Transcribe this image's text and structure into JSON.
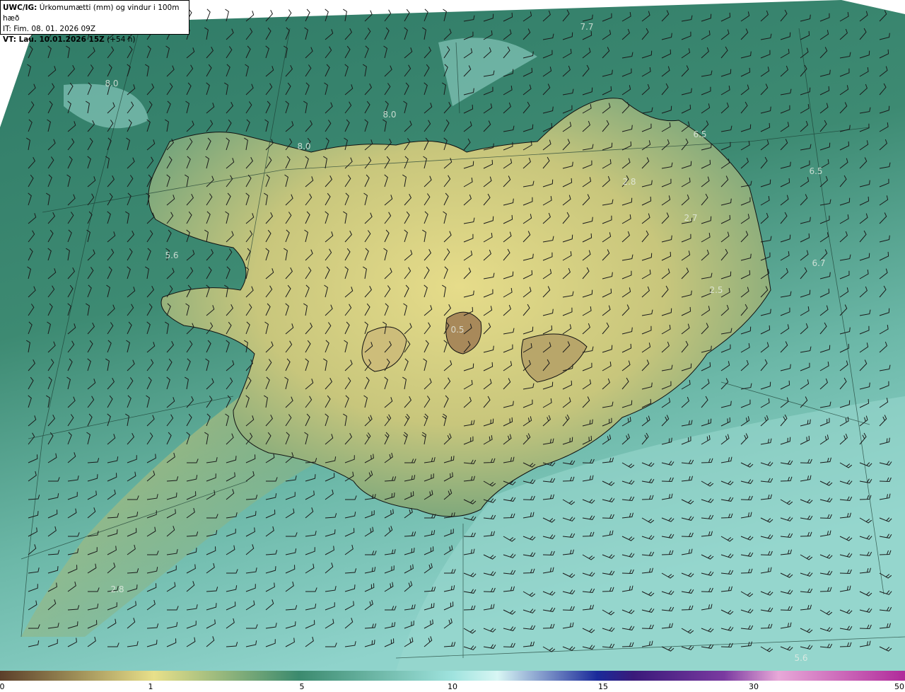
{
  "header": {
    "product": "UWC/IG:",
    "title": "Úrkomumætti (mm) og vindur i 100m hæð",
    "issue_time": "IT: Fim. 08. 01. 2026 09Z",
    "valid_prefix": "VT: Lau. 10.01.2026 15Z",
    "valid_suffix": "(+54 h)"
  },
  "colorbar": {
    "ticks": [
      "0",
      "1",
      "5",
      "10",
      "15",
      "30",
      "50"
    ],
    "colors": [
      "#5b3f2a",
      "#9a8a55",
      "#e8e08a",
      "#3b8a6e",
      "#9fe3de",
      "#d8f6f4",
      "#1a2a9a",
      "#3a1a7a",
      "#7a3aa0",
      "#e8a8d8",
      "#b02a9a"
    ]
  },
  "map_labels": [
    "7.7",
    "8.0",
    "8.0",
    "8.0",
    "6.5",
    "6.5",
    "2.8",
    "2.7",
    "5.6",
    "6.7",
    "2.5",
    "0.5",
    "2.8",
    "5.6"
  ]
}
